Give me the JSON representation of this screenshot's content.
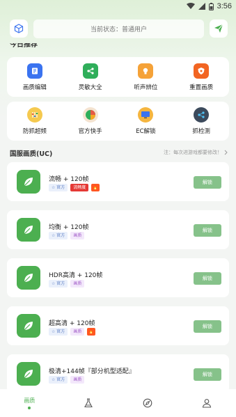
{
  "status_bar": {
    "time": "3:56",
    "icons": [
      "wifi-icon",
      "signal-icon",
      "battery-icon"
    ]
  },
  "header": {
    "status_text": "当前状态：普通用户",
    "left_icon": "cube-icon",
    "right_icon": "send-icon"
  },
  "section_peek": "今日推荐",
  "tools_row1": [
    {
      "label": "画质编辑",
      "icon": "doc-edit-icon",
      "color": "#3a73f0"
    },
    {
      "label": "灵敏大全",
      "icon": "share-icon",
      "color": "#2fae5a"
    },
    {
      "label": "听声辨位",
      "icon": "lightbulb-icon",
      "color": "#f5a238"
    },
    {
      "label": "重置画质",
      "icon": "shield-icon",
      "color": "#f26522"
    }
  ],
  "tools_row2": [
    {
      "label": "防抓超频",
      "icon": "sliders-icon",
      "color": "#f5b53f"
    },
    {
      "label": "官方快手",
      "icon": "pie-icon",
      "color": "#e55a46"
    },
    {
      "label": "EC解锁",
      "icon": "monitor-icon",
      "color": "#f5a623"
    },
    {
      "label": "抓检测",
      "icon": "network-icon",
      "color": "#3c4a5c"
    }
  ],
  "section": {
    "title": "国服画质(UC)",
    "note": "注：每次进游戏都要修改！"
  },
  "items": [
    {
      "title": "流畅 + 120帧",
      "tags": [
        {
          "text": "官方",
          "type": "official"
        },
        {
          "text": "流畅度",
          "type": "red"
        },
        {
          "text": "🔥",
          "type": "fire"
        }
      ],
      "button": "解锁"
    },
    {
      "title": "均衡 + 120帧",
      "tags": [
        {
          "text": "官方",
          "type": "official"
        },
        {
          "text": "画质",
          "type": "quality"
        }
      ],
      "button": "解锁"
    },
    {
      "title": "HDR高清 + 120帧",
      "tags": [
        {
          "text": "官方",
          "type": "official"
        },
        {
          "text": "画质",
          "type": "quality"
        }
      ],
      "button": "解锁"
    },
    {
      "title": "超高清 + 120帧",
      "tags": [
        {
          "text": "官方",
          "type": "official"
        },
        {
          "text": "画质",
          "type": "quality"
        },
        {
          "text": "🔥",
          "type": "fire"
        }
      ],
      "button": "解锁"
    },
    {
      "title": "极清+144帧『部分机型适配』",
      "tags": [
        {
          "text": "官方",
          "type": "official"
        },
        {
          "text": "画质",
          "type": "quality"
        }
      ],
      "button": "解锁"
    }
  ],
  "bottom_nav": [
    {
      "label": "画质",
      "icon": "",
      "active": true
    },
    {
      "label": "",
      "icon": "flask-icon",
      "active": false
    },
    {
      "label": "",
      "icon": "compass-icon",
      "active": false
    },
    {
      "label": "",
      "icon": "user-icon",
      "active": false
    }
  ],
  "colors": {
    "accent": "#4caf50",
    "button": "#86c28a",
    "background": "#f3f5f3"
  }
}
